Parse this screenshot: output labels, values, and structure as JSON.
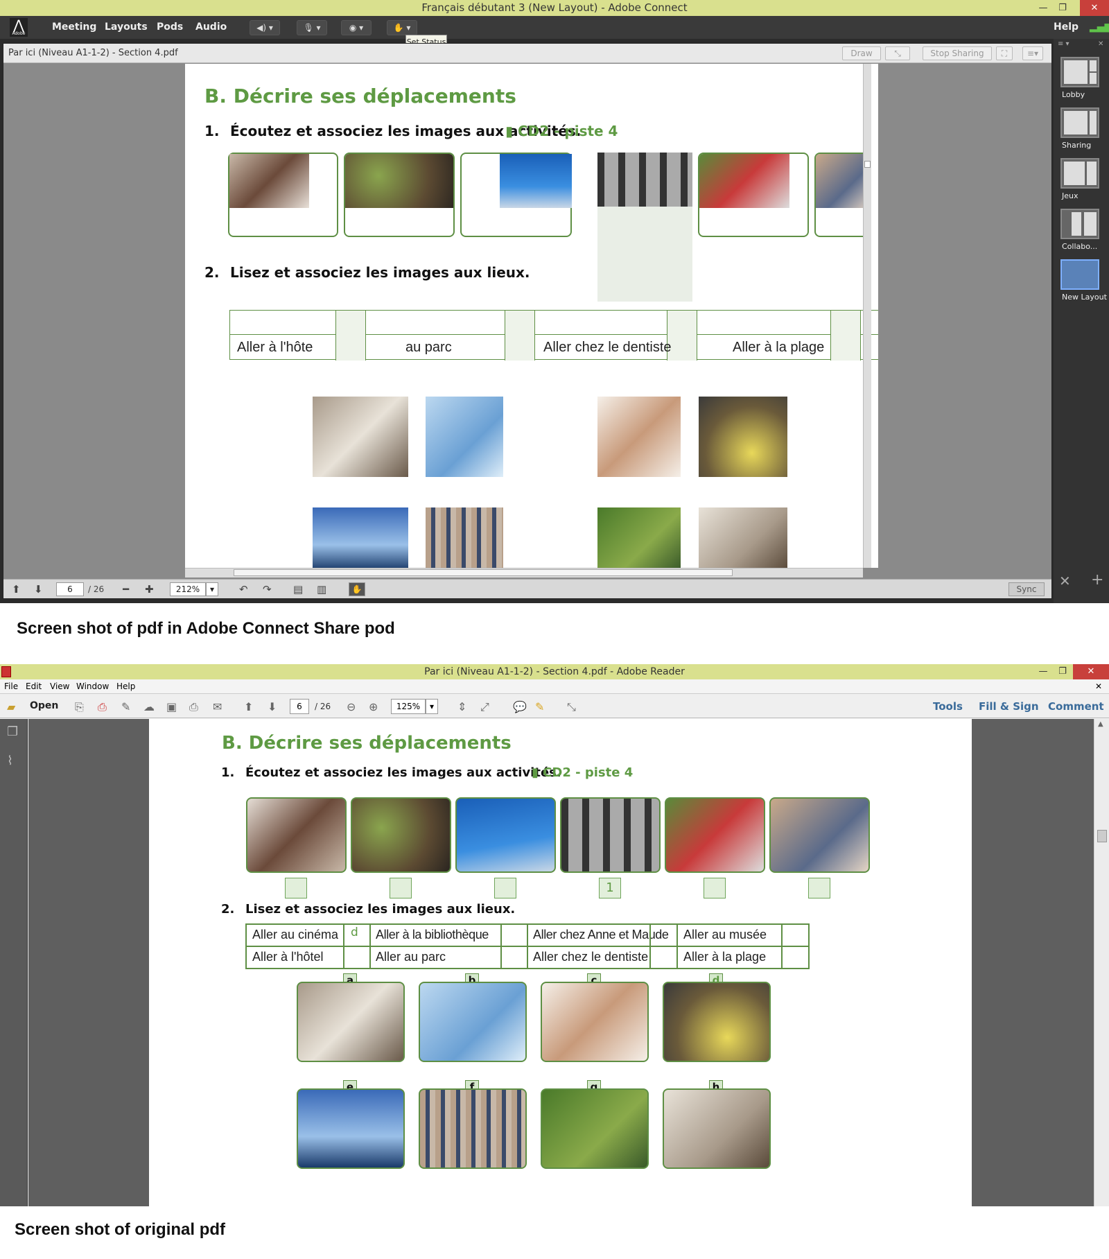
{
  "connect": {
    "window_title": "Français débutant 3 (New Layout) - Adobe Connect",
    "logo_text": "Adobe",
    "menu": [
      "Meeting",
      "Layouts",
      "Pods",
      "Audio"
    ],
    "help": "Help",
    "tooltip": "Set Status",
    "pod_title": "Par ici (Niveau A1-1-2) - Section 4.pdf",
    "buttons": {
      "draw": "Draw",
      "stop_sharing": "Stop Sharing",
      "sync": "Sync"
    },
    "page_current": "6",
    "page_total": "/ 26",
    "zoom": "212%",
    "layouts": [
      {
        "label": "Lobby"
      },
      {
        "label": "Sharing"
      },
      {
        "label": "Jeux"
      },
      {
        "label": "Collabo..."
      },
      {
        "label": "New Layout"
      }
    ],
    "doc": {
      "heading": "B. Décrire ses déplacements",
      "q1_num": "1.",
      "q1": "Écoutez et associez les images aux activités.",
      "q1_audio": "CD2 - piste 4",
      "q2_num": "2.",
      "q2": "Lisez et associez les images aux lieux.",
      "row2": [
        "Aller à l'hôte",
        "au parc",
        "Aller chez le dentiste",
        "Aller à la plage"
      ]
    }
  },
  "captions": {
    "top": "Screen shot of pdf in Adobe Connect Share pod",
    "bottom": "Screen shot of original pdf"
  },
  "reader": {
    "window_title": "Par ici (Niveau A1-1-2) - Section 4.pdf - Adobe Reader",
    "menu": [
      "File",
      "Edit",
      "View",
      "Window",
      "Help"
    ],
    "open": "Open",
    "page_current": "6",
    "page_total": "/ 26",
    "zoom": "125%",
    "tools": "Tools",
    "fill_sign": "Fill & Sign",
    "comment": "Comment",
    "doc": {
      "heading": "B. Décrire ses déplacements",
      "q1_num": "1.",
      "q1": "Écoutez et associez les images aux activités.",
      "q1_audio": "CD2 - piste 4",
      "activity_answers": [
        "",
        "",
        "",
        "1",
        "",
        ""
      ],
      "q2_num": "2.",
      "q2": "Lisez et associez les images aux lieux.",
      "table": [
        [
          {
            "text": "Aller au cinéma",
            "ans": "d"
          },
          {
            "text": "Aller à la bibliothèque",
            "ans": ""
          },
          {
            "text": "Aller chez Anne et Maude",
            "ans": ""
          },
          {
            "text": "Aller au musée",
            "ans": ""
          }
        ],
        [
          {
            "text": "Aller à l'hôtel",
            "ans": ""
          },
          {
            "text": "Aller au parc",
            "ans": ""
          },
          {
            "text": "Aller chez le dentiste",
            "ans": ""
          },
          {
            "text": "Aller à la plage",
            "ans": ""
          }
        ]
      ],
      "image_labels": [
        "a",
        "b",
        "c",
        "d",
        "e",
        "f",
        "g",
        "h"
      ],
      "label_d_mark": "d"
    }
  },
  "colors": {
    "accent_green": "#5e9a43",
    "title_bar": "#d9e08e",
    "close_red": "#c8403b",
    "link_blue": "#3a6b9a"
  }
}
